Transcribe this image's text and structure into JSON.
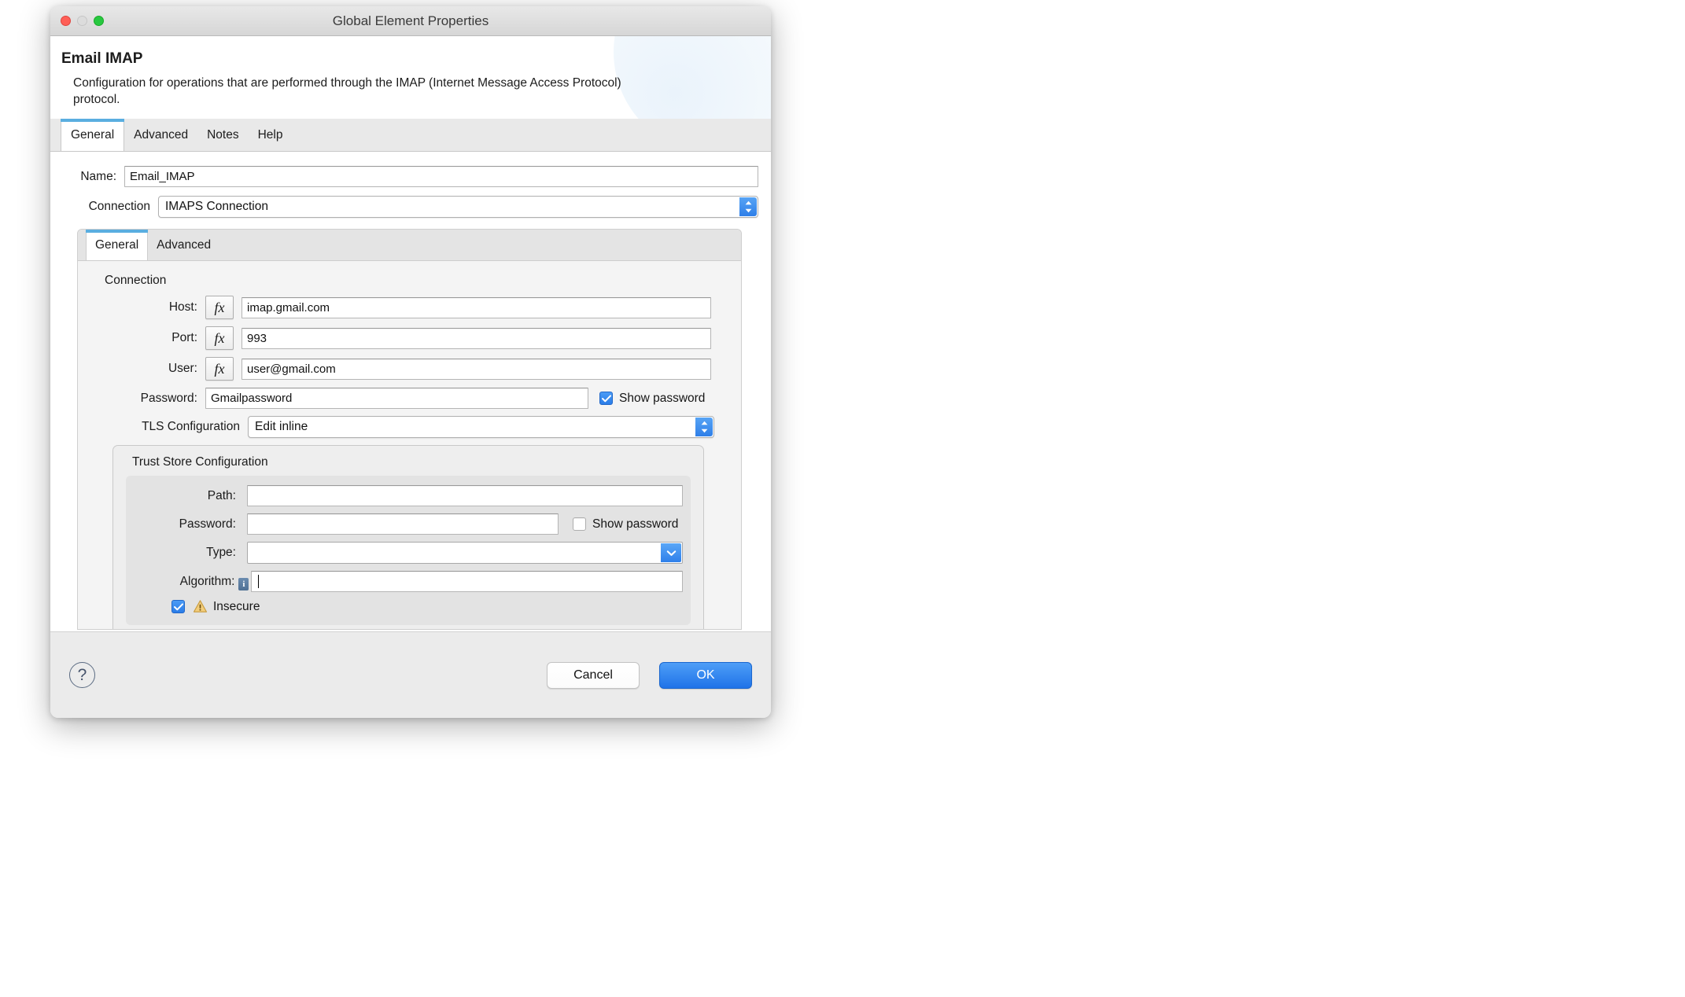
{
  "window": {
    "title": "Global Element Properties",
    "traffic_lights": [
      "close-red",
      "minimize-disabled",
      "zoom-green"
    ]
  },
  "header": {
    "title": "Email IMAP",
    "description": "Configuration for operations that are performed through the IMAP (Internet Message Access Protocol) protocol."
  },
  "outer_tabs": [
    {
      "label": "General",
      "active": true
    },
    {
      "label": "Advanced",
      "active": false
    },
    {
      "label": "Notes",
      "active": false
    },
    {
      "label": "Help",
      "active": false
    }
  ],
  "form": {
    "name_label": "Name:",
    "name_value": "Email_IMAP",
    "connection_label": "Connection",
    "connection_value": "IMAPS Connection"
  },
  "inner_tabs": [
    {
      "label": "General",
      "active": true
    },
    {
      "label": "Advanced",
      "active": false
    }
  ],
  "connection_group": {
    "title": "Connection",
    "host_label": "Host:",
    "host_value": "imap.gmail.com",
    "port_label": "Port:",
    "port_value": "993",
    "user_label": "User:",
    "user_value": "user@gmail.com",
    "password_label": "Password:",
    "password_value": "Gmailpassword",
    "show_password_label": "Show password",
    "show_password_checked": true,
    "fx_label": "fx",
    "tls_label": "TLS Configuration",
    "tls_value": "Edit inline"
  },
  "trust_store": {
    "title": "Trust Store Configuration",
    "path_label": "Path:",
    "path_value": "",
    "password_label": "Password:",
    "password_value": "",
    "show_password_label": "Show password",
    "show_password_checked": false,
    "type_label": "Type:",
    "type_value": "",
    "algorithm_label": "Algorithm:",
    "algorithm_value": "",
    "algorithm_info_glyph": "i",
    "insecure_label": "Insecure",
    "insecure_checked": true
  },
  "footer": {
    "help_glyph": "?",
    "cancel_label": "Cancel",
    "ok_label": "OK"
  },
  "colors": {
    "accent_blue": "#2f7fe8",
    "tab_indicator": "#5aaee0",
    "warning_amber": "#f0c674"
  }
}
